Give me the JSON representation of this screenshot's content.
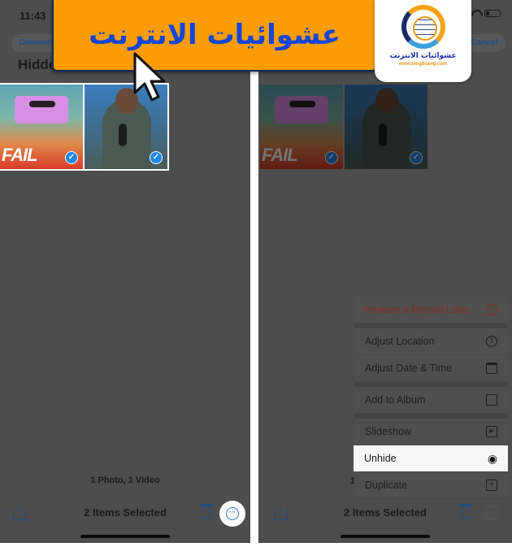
{
  "left_screen": {
    "status_time": "11:43",
    "deselect_label": "Deselect All",
    "album_title": "Hidden",
    "thumbnails": [
      {
        "kind": "photo",
        "overlay_text": "FAIL",
        "selected": true
      },
      {
        "kind": "video",
        "selected": true
      }
    ],
    "counts_label": "1 Photo, 1 Video",
    "toolbar": {
      "share_icon": "share-icon",
      "title": "2 Items Selected",
      "trash_icon": "trash-icon",
      "more_icon": "ellipsis-circle-icon",
      "more_glyph": "···"
    }
  },
  "right_screen": {
    "cancel_label": "Cancel",
    "partial_counts_label": "1",
    "menu": {
      "groups": [
        [
          {
            "label": "Feature a Person Less",
            "icon": "minus-circle-icon",
            "glyph": "−",
            "destructive": true
          }
        ],
        [
          {
            "label": "Adjust Location",
            "icon": "location-info-icon",
            "glyph": "!"
          },
          {
            "label": "Adjust Date & Time",
            "icon": "calendar-clock-icon",
            "glyph": ""
          }
        ],
        [
          {
            "label": "Add to Album",
            "icon": "add-to-album-icon",
            "glyph": ""
          }
        ],
        [
          {
            "label": "Slideshow",
            "icon": "play-rectangle-icon",
            "glyph": "▶"
          },
          {
            "label": "Unhide",
            "icon": "eye-icon",
            "glyph": "👁",
            "highlighted": true
          },
          {
            "label": "Duplicate",
            "icon": "duplicate-icon",
            "glyph": "+"
          }
        ]
      ]
    },
    "toolbar": {
      "title": "2 Items Selected"
    }
  },
  "overlays": {
    "banner_text": "عشوائيات الانترنت",
    "logo_name": "عشوائيات الانترنت",
    "logo_url": "www.blog8sang.com"
  },
  "colors": {
    "banner_bg": "#fb9c02",
    "banner_text": "#1246d8",
    "dim_background": "#4d4d4d",
    "accent_blue": "#2f7de1",
    "destructive_red": "#8a2a2a"
  }
}
